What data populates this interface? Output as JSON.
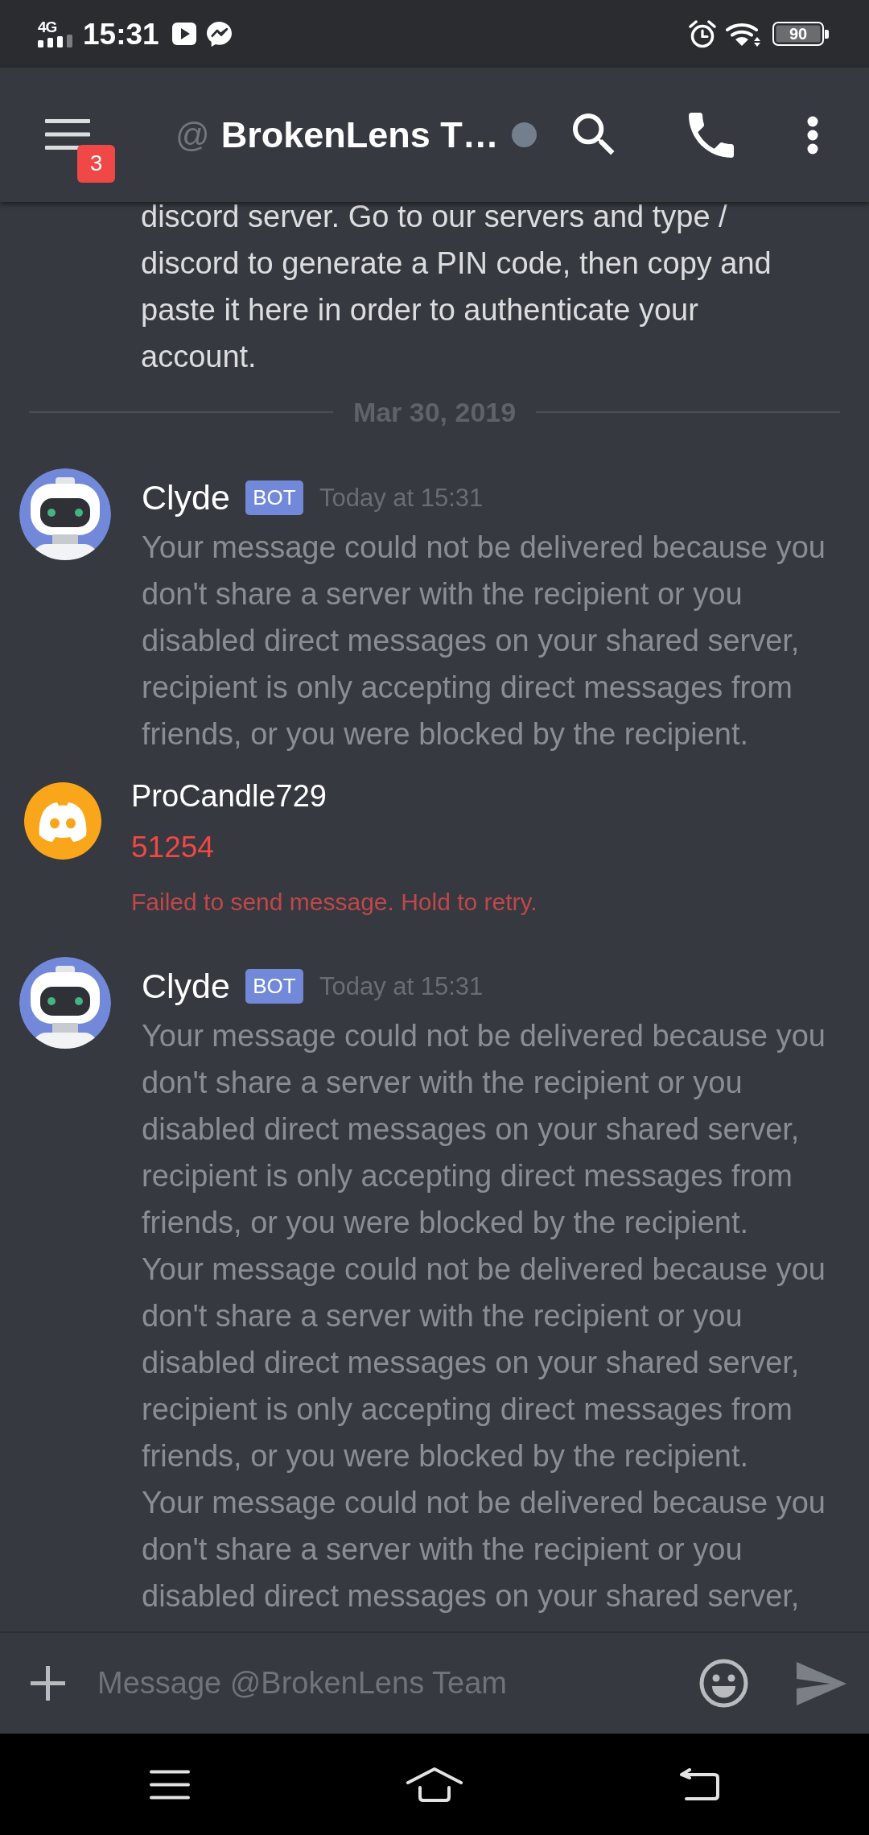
{
  "status_bar": {
    "network": "4G",
    "time": "15:31",
    "battery": "90"
  },
  "header": {
    "unread_count": "3",
    "at_sign": "@",
    "title": "BrokenLens T…",
    "online": false
  },
  "messages": [
    {
      "kind": "continuation",
      "dimmed": false,
      "paragraphs": [
        "discord server. Go to our servers and type /\ndiscord to generate a PIN code, then copy and\npaste it here in order to authenticate your\naccount."
      ]
    },
    {
      "kind": "date_divider",
      "date": "Mar 30, 2019"
    },
    {
      "kind": "group",
      "avatar": {
        "kind": "robot"
      },
      "author": "Clyde",
      "tag": "BOT",
      "timestamp": "Today at 15:31",
      "dimmed": true,
      "paragraphs": [
        "Your message could not be delivered because you\ndon't share a server with the recipient or you\ndisabled direct messages on your shared server,\nrecipient is only accepting direct messages from\nfriends, or you were blocked by the recipient."
      ]
    },
    {
      "kind": "group",
      "avatar": {
        "kind": "logo"
      },
      "author": "ProCandle729",
      "failed": true,
      "paragraphs": [
        "51254"
      ],
      "error": "Failed to send message. Hold to retry."
    },
    {
      "kind": "group",
      "avatar": {
        "kind": "robot"
      },
      "author": "Clyde",
      "tag": "BOT",
      "timestamp": "Today at 15:31",
      "dimmed": true,
      "paragraphs": [
        "Your message could not be delivered because you\ndon't share a server with the recipient or you\ndisabled direct messages on your shared server,\nrecipient is only accepting direct messages from\nfriends, or you were blocked by the recipient.",
        "Your message could not be delivered because you\ndon't share a server with the recipient or you\ndisabled direct messages on your shared server,\nrecipient is only accepting direct messages from\nfriends, or you were blocked by the recipient.",
        "Your message could not be delivered because you\ndon't share a server with the recipient or you\ndisabled direct messages on your shared server,"
      ]
    }
  ],
  "composer": {
    "placeholder": "Message @BrokenLens Team"
  }
}
